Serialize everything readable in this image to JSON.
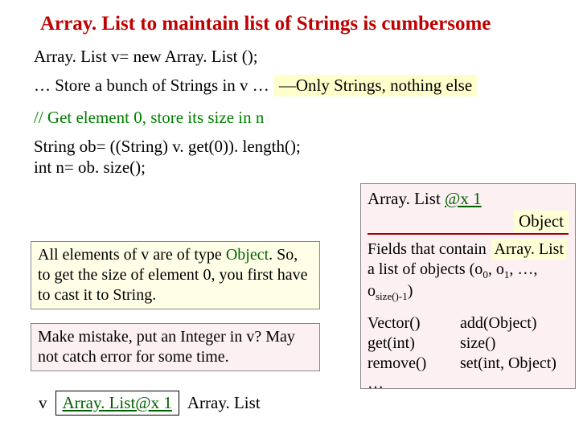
{
  "title": "Array. List to maintain list of Strings is cumbersome",
  "line1": "Array. List v= new Array. List ();",
  "line2a": "… Store a bunch of Strings in v …",
  "line2b": "—Only Strings, nothing else",
  "comment": "// Get element 0, store its size in n",
  "code1": "String ob= ((String) v. get(0)). length();",
  "code2": "int n= ob. size();",
  "objHeader1": "Array. List ",
  "objHeader2": "@x 1",
  "objectTag": "Object",
  "arrayListTag": "Array. List",
  "fieldsPre": "Fields that contain a list of objects (o",
  "fieldsSub0": "0",
  "fieldsMid1": ", o",
  "fieldsSub1": "1",
  "fieldsMid2": ", …, o",
  "fieldsSubN": "size()-1",
  "fieldsPost": ")",
  "methods": {
    "r1c1": "Vector()",
    "r1c2": "add(Object)",
    "r2c1": "get(int)",
    "r2c2": "size()",
    "r3c1": "remove()",
    "r3c2": "set(int, Object)",
    "r4": "…"
  },
  "explain1a": "All elements of v are of type ",
  "explain1obj": "Object",
  "explain1b": ". So, to get the size of element 0, you first have to cast it to String.",
  "explain2": "Make mistake, put an Integer in v? May not catch error for some time.",
  "varLabel": "v",
  "varValue": "Array. List@x 1",
  "varType": "Array. List"
}
